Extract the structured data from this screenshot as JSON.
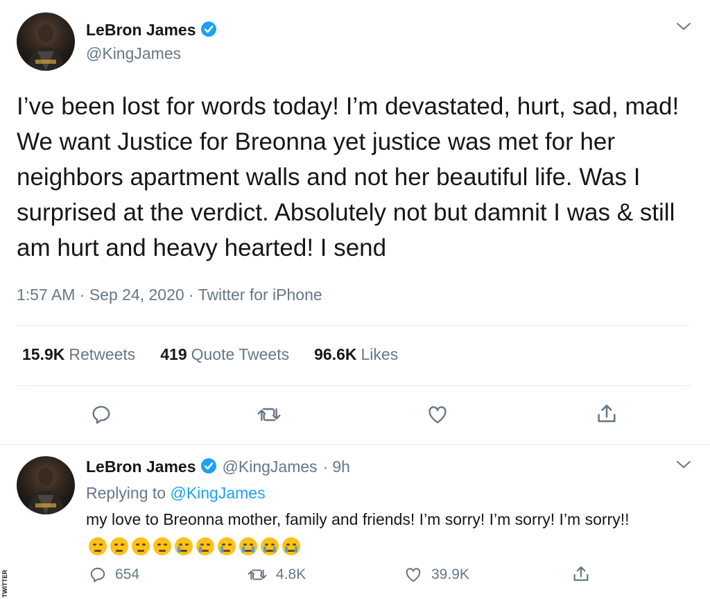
{
  "main_tweet": {
    "name": "LeBron James",
    "handle": "@KingJames",
    "text": "I’ve been lost for words today! I’m devastated, hurt, sad, mad! We want Justice for Breonna yet justice was met for her neighbors apartment walls and not her beautiful life. Was I surprised at the verdict. Absolutely not but damnit I was & still am hurt and heavy hearted! I send",
    "meta": "1:57 AM · Sep 24, 2020 · Twitter for iPhone",
    "stats": {
      "retweets_count": "15.9K",
      "retweets_label": "Retweets",
      "quotes_count": "419",
      "quotes_label": "Quote Tweets",
      "likes_count": "96.6K",
      "likes_label": "Likes"
    },
    "actions": [
      "reply-icon",
      "retweet-icon",
      "like-icon",
      "share-icon"
    ]
  },
  "reply_tweet": {
    "name": "LeBron James",
    "handle": "@KingJames",
    "separator": "·",
    "time": "9h",
    "replying_prefix": "Replying to",
    "replying_to": "@KingJames",
    "text": "my love to Breonna mother, family and friends! I’m sorry! I’m sorry! I’m sorry!!",
    "emojis": [
      "pensive-face",
      "pensive-face",
      "rolling-eyes-face",
      "rolling-eyes-face",
      "crying-face",
      "crying-face",
      "crying-face",
      "loudly-crying-face",
      "loudly-crying-face",
      "loudly-crying-face"
    ],
    "reply_count": "654",
    "retweet_count": "4.8K",
    "like_count": "39.9K"
  },
  "watermark": "TWITTER",
  "colors": {
    "accent": "#1da1f2",
    "text": "#14171a",
    "secondary": "#657786",
    "divider": "#e6ecf0"
  }
}
